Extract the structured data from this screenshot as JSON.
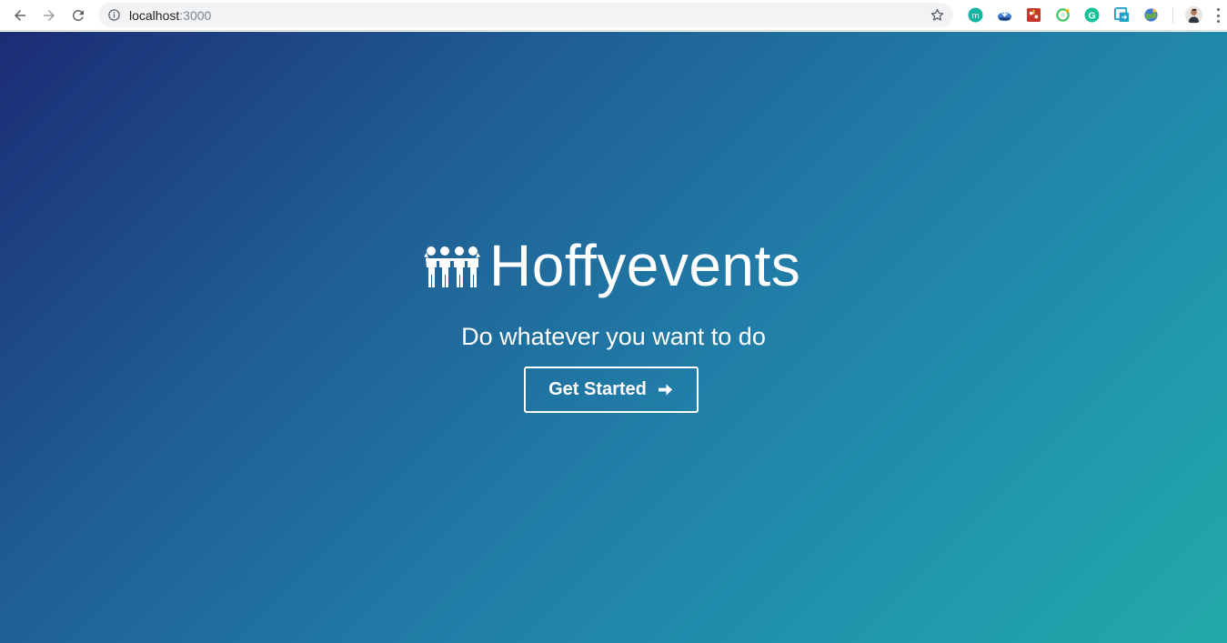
{
  "browser": {
    "url_host": "localhost",
    "url_port": ":3000",
    "icons": {
      "back": "arrow-left-icon",
      "forward": "arrow-right-icon",
      "reload": "reload-icon",
      "site_info": "info-icon",
      "bookmark": "star-icon",
      "menu": "kebab-menu-icon"
    },
    "extensions": [
      {
        "name": "m-extension-icon",
        "color": "#17b3a3"
      },
      {
        "name": "cloud-download-extension-icon",
        "color": "#3c7ed8"
      },
      {
        "name": "red-square-extension-icon",
        "color": "#c7382c"
      },
      {
        "name": "green-ring-extension-icon",
        "color": "#4cc46a"
      },
      {
        "name": "grammarly-extension-icon",
        "color": "#15c39a"
      },
      {
        "name": "teal-window-extension-icon",
        "color": "#1fa3c5"
      },
      {
        "name": "globe-extension-icon",
        "color": "#6aa84f"
      }
    ]
  },
  "page": {
    "brand_title": "Hoffyevents",
    "brand_icon": "people-group-icon",
    "tagline": "Do whatever you want to do",
    "cta_label": "Get Started",
    "cta_icon": "arrow-right-circle-icon",
    "gradient_start": "#1c2c74",
    "gradient_end": "#22a9a8"
  }
}
